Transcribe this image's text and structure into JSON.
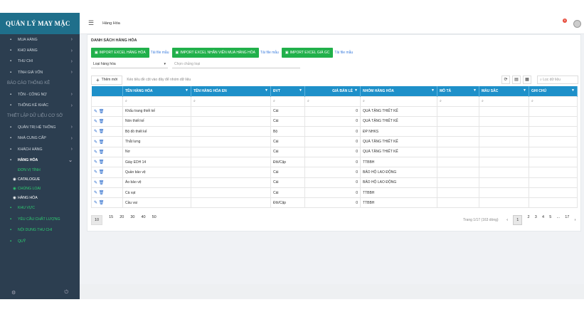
{
  "app": {
    "logo": "QUẢN LÝ MAY MẶC"
  },
  "topbar": {
    "breadcrumb": "Hàng Hóa",
    "badge": "9"
  },
  "sidebar": {
    "items_top": [
      {
        "label": "MUA HÀNG",
        "icon": "cart-icon"
      },
      {
        "label": "KHO HÀNG",
        "icon": "warehouse-icon"
      },
      {
        "label": "THU CHI",
        "icon": "money-icon"
      },
      {
        "label": "TÍNH GIÁ VỐN",
        "icon": "calculator-icon"
      }
    ],
    "section_report": "BÁO CÁO THỐNG KÊ",
    "items_report": [
      {
        "label": "TỒN - CÔNG NỢ",
        "icon": "scale-icon"
      },
      {
        "label": "THỐNG KÊ KHÁC",
        "icon": "chart-icon"
      }
    ],
    "section_setup": "THIẾT LẬP DỮ LIỆU CƠ SỞ",
    "items_setup": [
      {
        "label": "QUẢN TRỊ HỆ THỐNG",
        "icon": "system-icon"
      },
      {
        "label": "NHÀ CUNG CẤP",
        "icon": "supplier-icon"
      },
      {
        "label": "KHÁCH HÀNG",
        "icon": "users-icon"
      },
      {
        "label": "HÀNG HÓA",
        "icon": "goods-icon"
      }
    ],
    "subitems": [
      {
        "label": "ĐƠN VỊ TÍNH"
      },
      {
        "label": "CATALOGUE"
      },
      {
        "label": "CHỦNG LOẠI"
      },
      {
        "label": "HÀNG HÓA"
      }
    ],
    "items_bottom": [
      {
        "label": "KHU VỰC",
        "icon": "area-icon"
      },
      {
        "label": "YÊU CẦU CHẤT LƯỢNG",
        "icon": "quality-icon"
      },
      {
        "label": "NỘI DUNG THU CHI",
        "icon": "content-icon"
      },
      {
        "label": "QUỸ",
        "icon": "fund-icon"
      }
    ]
  },
  "main": {
    "title": "DANH SÁCH HÀNG HÓA",
    "buttons": [
      {
        "label": "IMPORT EXCEL HÀNG HÓA",
        "link": "Tải file mẫu"
      },
      {
        "label": "IMPORT EXCEL NHÂN VIÊN MUA HÀNG HÓA",
        "link": "Tải file mẫu"
      },
      {
        "label": "IMPORT EXCEL GIÁ GC",
        "link": "Tải file mẫu"
      }
    ],
    "filter1": "Loại hàng hóa",
    "filter2_placeholder": "Chọn chủng loại",
    "add_label": "Thêm mới",
    "group_hint": "Kéo tiêu đề cột vào đây để nhóm dữ liệu",
    "search_placeholder": "Lọc dữ liệu",
    "columns": [
      "TÊN HÀNG HÓA",
      "TÊN HÀNG HÓA EN",
      "ĐVT",
      "GIÁ BÁN LẺ",
      "NHÓM HÀNG HÓA",
      "MÔ TẢ",
      "MÀU SẮC",
      "GHI CHÚ"
    ],
    "rows": [
      [
        "Khẩu trang thiết kế",
        "",
        "Cái",
        "0",
        "QUÀ TẶNG THIẾT KẾ",
        "",
        "",
        ""
      ],
      [
        "Nón thiết kế",
        "",
        "Cái",
        "0",
        "QUÀ TẶNG THIẾT KẾ",
        "",
        "",
        ""
      ],
      [
        "Bộ đồ thiết kế",
        "",
        "Bộ",
        "0",
        "ĐP NHKS",
        "",
        "",
        ""
      ],
      [
        "Thắt lưng",
        "",
        "Cái",
        "0",
        "QUÀ TẶNG THIẾT KẾ",
        "",
        "",
        ""
      ],
      [
        "Nơ",
        "",
        "Cái",
        "0",
        "QUÀ TẶNG THIẾT KẾ",
        "",
        "",
        ""
      ],
      [
        "Giày EDH 14",
        "",
        "Đôi/Cặp",
        "0",
        "TTBBH",
        "",
        "",
        ""
      ],
      [
        "Quần bảo vệ",
        "",
        "Cái",
        "0",
        "BẢO HỘ LAO ĐỘNG",
        "",
        "",
        ""
      ],
      [
        "Áo bảo vệ",
        "",
        "Cái",
        "0",
        "BẢO HỘ LAO ĐỘNG",
        "",
        "",
        ""
      ],
      [
        "Cà vạt",
        "",
        "Cái",
        "0",
        "TTBBH",
        "",
        "",
        ""
      ],
      [
        "Cầu vai",
        "",
        "Đôi/Cặp",
        "0",
        "TTBBH",
        "",
        "",
        ""
      ]
    ],
    "page_sizes": [
      "10",
      "15",
      "20",
      "30",
      "40",
      "50"
    ],
    "page_info": "Trang 1/17 (163 dòng)",
    "pages": [
      "1",
      "2",
      "3",
      "4",
      "5",
      "...",
      "17"
    ]
  }
}
